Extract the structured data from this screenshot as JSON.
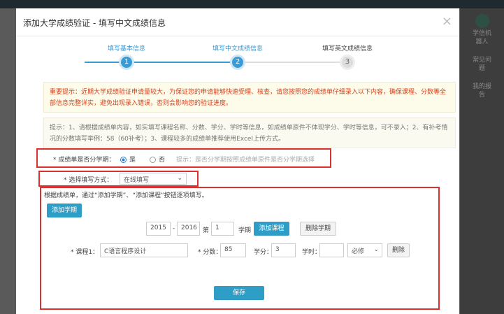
{
  "side": {
    "items": [
      "学信机器人",
      "常见问题",
      "我的报告"
    ]
  },
  "modal": {
    "title": "添加大学成绩验证 - 填写中文成绩信息",
    "close": "×"
  },
  "steps": [
    {
      "label": "填写基本信息",
      "num": "1"
    },
    {
      "label": "填写中文成绩信息",
      "num": "2"
    },
    {
      "label": "填写英文成绩信息",
      "num": "3"
    }
  ],
  "warning": "重要提示：近期大学成绩验证申请量较大，为保证您的申请能够快速受理、核查，请您按照您的成绩单仔细录入以下内容，确保课程、分数等全部信息完整详实，避免出现录入错误，否则会影响您的验证进度。",
  "hint": "提示：1、请根据成绩单内容，如实填写课程名称、分数、学分、学时等信息，如成绩单原件不体现学分、学时等信息，可不录入；2、有补考情况的分数填写举例：58（60补考）；3、课程较多的成绩单推荐使用Excel上传方式。",
  "semester": {
    "label": "* 成绩单是否分学期：",
    "yes": "是",
    "no": "否",
    "tip": "提示：是否分学期按照成绩单原件是否分学期选择"
  },
  "method": {
    "label": "* 选择填写方式：",
    "value": "在线填写"
  },
  "form": {
    "intro": "根据成绩单，通过“添加学期”、“添加课程”按钮逐项填写。",
    "add_term": "添加学期",
    "year_from": "2015",
    "dash": "-",
    "year_to": "2016",
    "di": "第",
    "term_no": "1",
    "term_unit": "学期",
    "add_course": "添加课程",
    "del_term": "删除学期",
    "course_label": "* 课程1：",
    "course_value": "C语言程序设计",
    "score_label": "* 分数：",
    "score_value": "85",
    "credit_label": "学分：",
    "credit_value": "3",
    "hours_label": "学时：",
    "hours_value": "",
    "type_value": "必修",
    "delete": "删除",
    "save": "保存"
  }
}
